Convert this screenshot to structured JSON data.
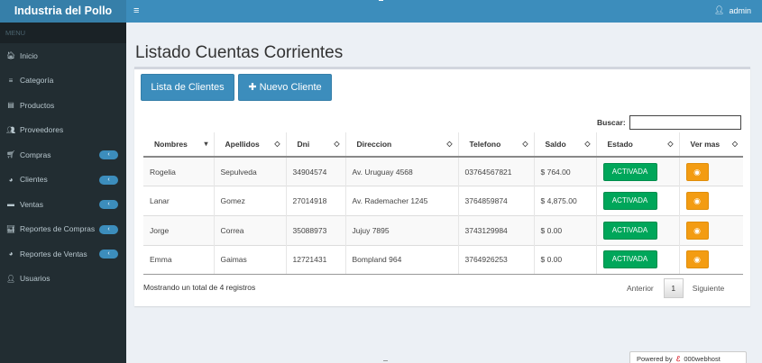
{
  "brand": "Industria del Pollo",
  "user": "admin",
  "sidebar": {
    "header": "MENU",
    "items": [
      {
        "label": "Inicio",
        "icon": "🏠︎",
        "chev": false
      },
      {
        "label": "Categoría",
        "icon": "≡",
        "chev": false
      },
      {
        "label": "Productos",
        "icon": "▤",
        "chev": false
      },
      {
        "label": "Proveedores",
        "icon": "👥︎",
        "chev": false
      },
      {
        "label": "Compras",
        "icon": "🛒︎",
        "chev": true
      },
      {
        "label": "Clientes",
        "icon": "◕",
        "chev": true
      },
      {
        "label": "Ventas",
        "icon": "▬",
        "chev": true
      },
      {
        "label": "Reportes de Compras",
        "icon": "📊︎",
        "chev": true
      },
      {
        "label": "Reportes de Ventas",
        "icon": "◕",
        "chev": true
      },
      {
        "label": "Usuarios",
        "icon": "👤︎",
        "chev": false
      }
    ],
    "chev_symbol": "‹"
  },
  "page_title": "Listado Cuentas Corrientes",
  "buttons": {
    "list_clients": "Lista de Clientes",
    "new_client": "✚ Nuevo Cliente"
  },
  "search": {
    "label": "Buscar:",
    "value": ""
  },
  "table": {
    "columns": [
      "Nombres",
      "Apellidos",
      "Dni",
      "Direccion",
      "Telefono",
      "Saldo",
      "Estado",
      "Ver mas"
    ],
    "rows": [
      {
        "nombres": "Rogelia",
        "apellidos": "Sepulveda",
        "dni": "34904574",
        "direccion": "Av. Uruguay 4568",
        "telefono": "03764567821",
        "saldo": "$ 764.00",
        "estado": "ACTIVADA"
      },
      {
        "nombres": "Lanar",
        "apellidos": "Gomez",
        "dni": "27014918",
        "direccion": "Av. Rademacher 1245",
        "telefono": "3764859874",
        "saldo": "$ 4,875.00",
        "estado": "ACTIVADA"
      },
      {
        "nombres": "Jorge",
        "apellidos": "Correa",
        "dni": "35088973",
        "direccion": "Jujuy 7895",
        "telefono": "3743129984",
        "saldo": "$ 0.00",
        "estado": "ACTIVADA"
      },
      {
        "nombres": "Emma",
        "apellidos": "Gaimas",
        "dni": "12721431",
        "direccion": "Bompland 964",
        "telefono": "3764926253",
        "saldo": "$ 0.00",
        "estado": "ACTIVADA"
      }
    ]
  },
  "info": "Mostrando un total de 4 registros",
  "pager": {
    "prev": "Anterior",
    "page": "1",
    "next": "Siguiente"
  },
  "powered": {
    "prefix": "Powered by",
    "brand": "000webhost"
  },
  "colors": {
    "accent": "#3c8dbc",
    "success": "#00a65a",
    "warning": "#f39c12",
    "sidebar": "#222d32"
  }
}
